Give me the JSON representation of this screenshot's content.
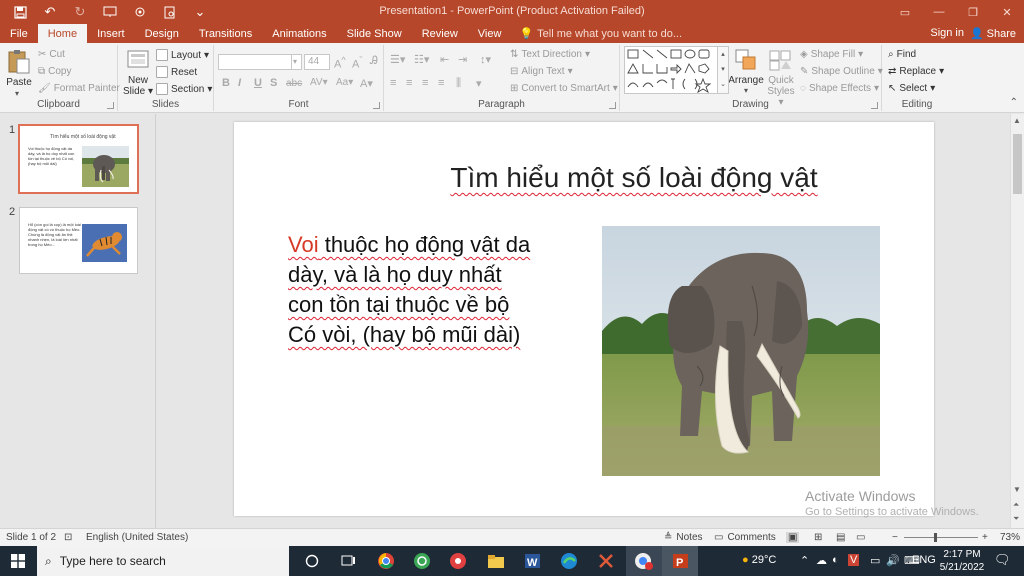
{
  "window": {
    "title": "Presentation1 - PowerPoint (Product Activation Failed)"
  },
  "tabs": [
    "File",
    "Home",
    "Insert",
    "Design",
    "Transitions",
    "Animations",
    "Slide Show",
    "Review",
    "View"
  ],
  "active_tab": "Home",
  "tell_me_placeholder": "Tell me what you want to do...",
  "signin_label": "Sign in",
  "share_label": "Share",
  "ribbon": {
    "clipboard": {
      "label": "Clipboard",
      "paste": "Paste",
      "cut": "Cut",
      "copy": "Copy",
      "format_painter": "Format Painter"
    },
    "slides": {
      "label": "Slides",
      "new_slide": "New",
      "new_slide_2": "Slide",
      "layout": "Layout",
      "reset": "Reset",
      "section": "Section"
    },
    "font": {
      "label": "Font",
      "size": "44"
    },
    "paragraph": {
      "label": "Paragraph",
      "text_direction": "Text Direction",
      "align_text": "Align Text",
      "convert_smartart": "Convert to SmartArt"
    },
    "drawing": {
      "label": "Drawing",
      "arrange": "Arrange",
      "quick_styles": "Quick",
      "quick_styles_2": "Styles",
      "shape_fill": "Shape Fill",
      "shape_outline": "Shape Outline",
      "shape_effects": "Shape Effects"
    },
    "editing": {
      "label": "Editing",
      "find": "Find",
      "replace": "Replace",
      "select": "Select"
    }
  },
  "thumbnails": [
    {
      "num": "1",
      "title": "Tìm hiểu một số loài động vật",
      "text": "Voi thuộc họ động vật da dày, và là họ duy nhất con tồn tại thuộc về bộ Có vòi, (hay bộ mũi dài)"
    },
    {
      "num": "2",
      "text": "Hổ (còn gọi là cọp) là một loài động vật có vú thuộc họ Mèo. Chúng là động vật ăn thịt nhanh nhẹn, là loài lớn nhất trong họ Mèo..."
    }
  ],
  "slide": {
    "title": "Tìm hiểu một số loài động vật",
    "body_red": "Voi",
    "body_line1": " thuộc họ động vật da",
    "body_line2": "dày, và là họ duy nhất",
    "body_line3": "con tồn tại thuộc về bộ",
    "body_line4": "Có vòi, (hay bộ mũi dài)"
  },
  "watermark": {
    "line1": "Activate Windows",
    "line2": "Go to Settings to activate Windows."
  },
  "status": {
    "slide_of": "Slide 1 of 2",
    "language": "English (United States)",
    "notes": "Notes",
    "comments": "Comments",
    "zoom": "73%"
  },
  "taskbar": {
    "search_placeholder": "Type here to search",
    "temperature": "29°C",
    "language": "ENG",
    "time": "2:17 PM",
    "date": "5/21/2022"
  },
  "colors": {
    "accent": "#b7472a",
    "title_red": "#d63a26",
    "taskbar": "#1e2a36"
  }
}
